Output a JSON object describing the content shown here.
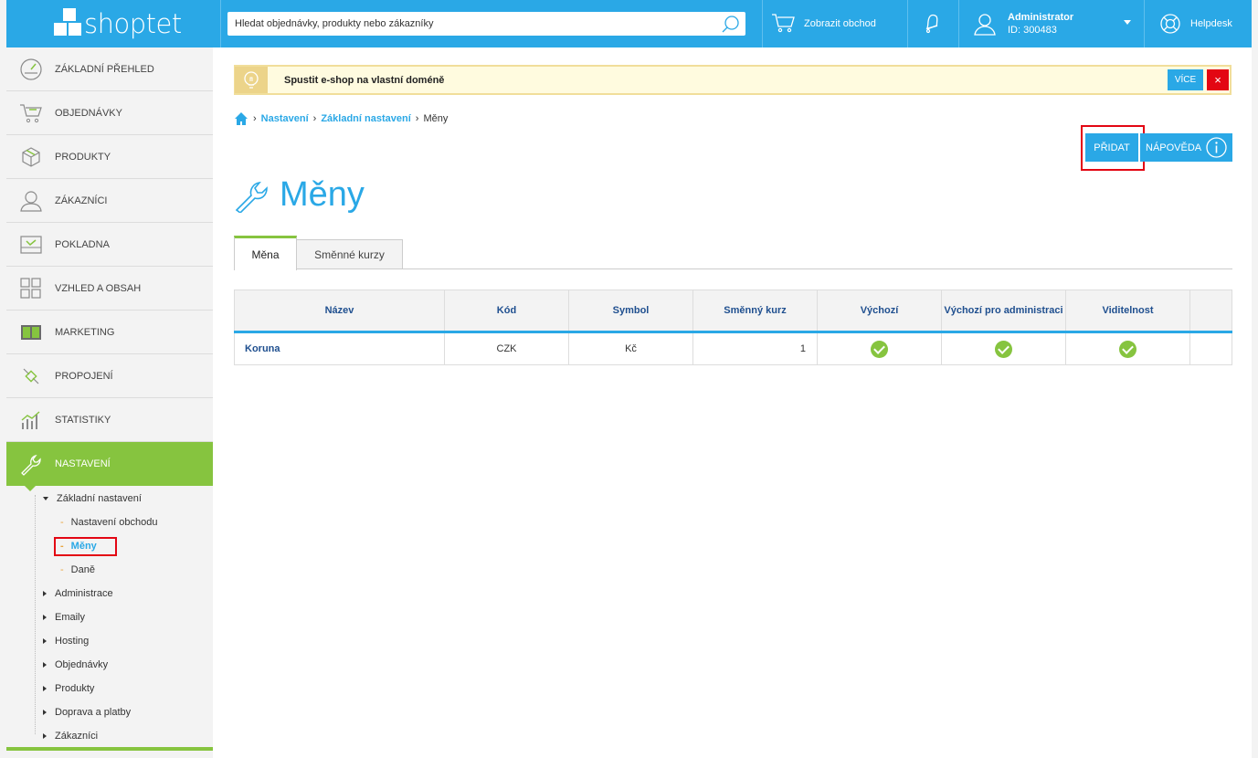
{
  "brand": {
    "logo_text": "shoptet"
  },
  "topbar": {
    "search_placeholder": "Hledat objednávky, produkty nebo zákazníky",
    "show_shop": "Zobrazit obchod",
    "user_name": "Administrator",
    "user_id": "ID: 300483",
    "helpdesk": "Helpdesk"
  },
  "sidebar": {
    "items": [
      {
        "label": "Základní přehled",
        "icon": "dashboard-icon"
      },
      {
        "label": "Objednávky",
        "icon": "cart-icon"
      },
      {
        "label": "Produkty",
        "icon": "box-icon"
      },
      {
        "label": "Zákazníci",
        "icon": "user-icon"
      },
      {
        "label": "Pokladna",
        "icon": "register-icon"
      },
      {
        "label": "Vzhled a obsah",
        "icon": "grid-icon"
      },
      {
        "label": "Marketing",
        "icon": "marketing-icon"
      },
      {
        "label": "Propojení",
        "icon": "plug-icon"
      },
      {
        "label": "Statistiky",
        "icon": "chart-icon"
      },
      {
        "label": "Nastavení",
        "icon": "wrench-icon"
      }
    ],
    "sub": {
      "basic": "Základní nastavení",
      "shop_settings": "Nastavení obchodu",
      "currencies": "Měny",
      "taxes": "Daně",
      "administration": "Administrace",
      "emails": "Emaily",
      "hosting": "Hosting",
      "orders": "Objednávky",
      "products": "Produkty",
      "shipping": "Doprava a platby",
      "customers": "Zákazníci"
    }
  },
  "notice": {
    "text": "Spustit e-shop na vlastní doméně",
    "more": "VÍCE",
    "close": "×"
  },
  "breadcrumb": {
    "l1": "Nastavení",
    "l2": "Základní nastavení",
    "current": "Měny"
  },
  "actions": {
    "add": "PŘIDAT",
    "help": "NÁPOVĚDA"
  },
  "page": {
    "title": "Měny"
  },
  "tabs": {
    "t1": "Měna",
    "t2": "Směnné kurzy"
  },
  "table": {
    "headers": {
      "name": "Název",
      "code": "Kód",
      "symbol": "Symbol",
      "rate": "Směnný kurz",
      "default": "Výchozí",
      "default_admin": "Výchozí pro administraci",
      "visibility": "Viditelnost"
    },
    "rows": [
      {
        "name": "Koruna",
        "code": "CZK",
        "symbol": "Kč",
        "rate": "1",
        "default": true,
        "default_admin": true,
        "visible": true
      }
    ]
  },
  "colors": {
    "accent": "#2aa8e6",
    "active": "#86c43f",
    "highlight": "#e30613",
    "notice_bg": "#fffbdf"
  }
}
